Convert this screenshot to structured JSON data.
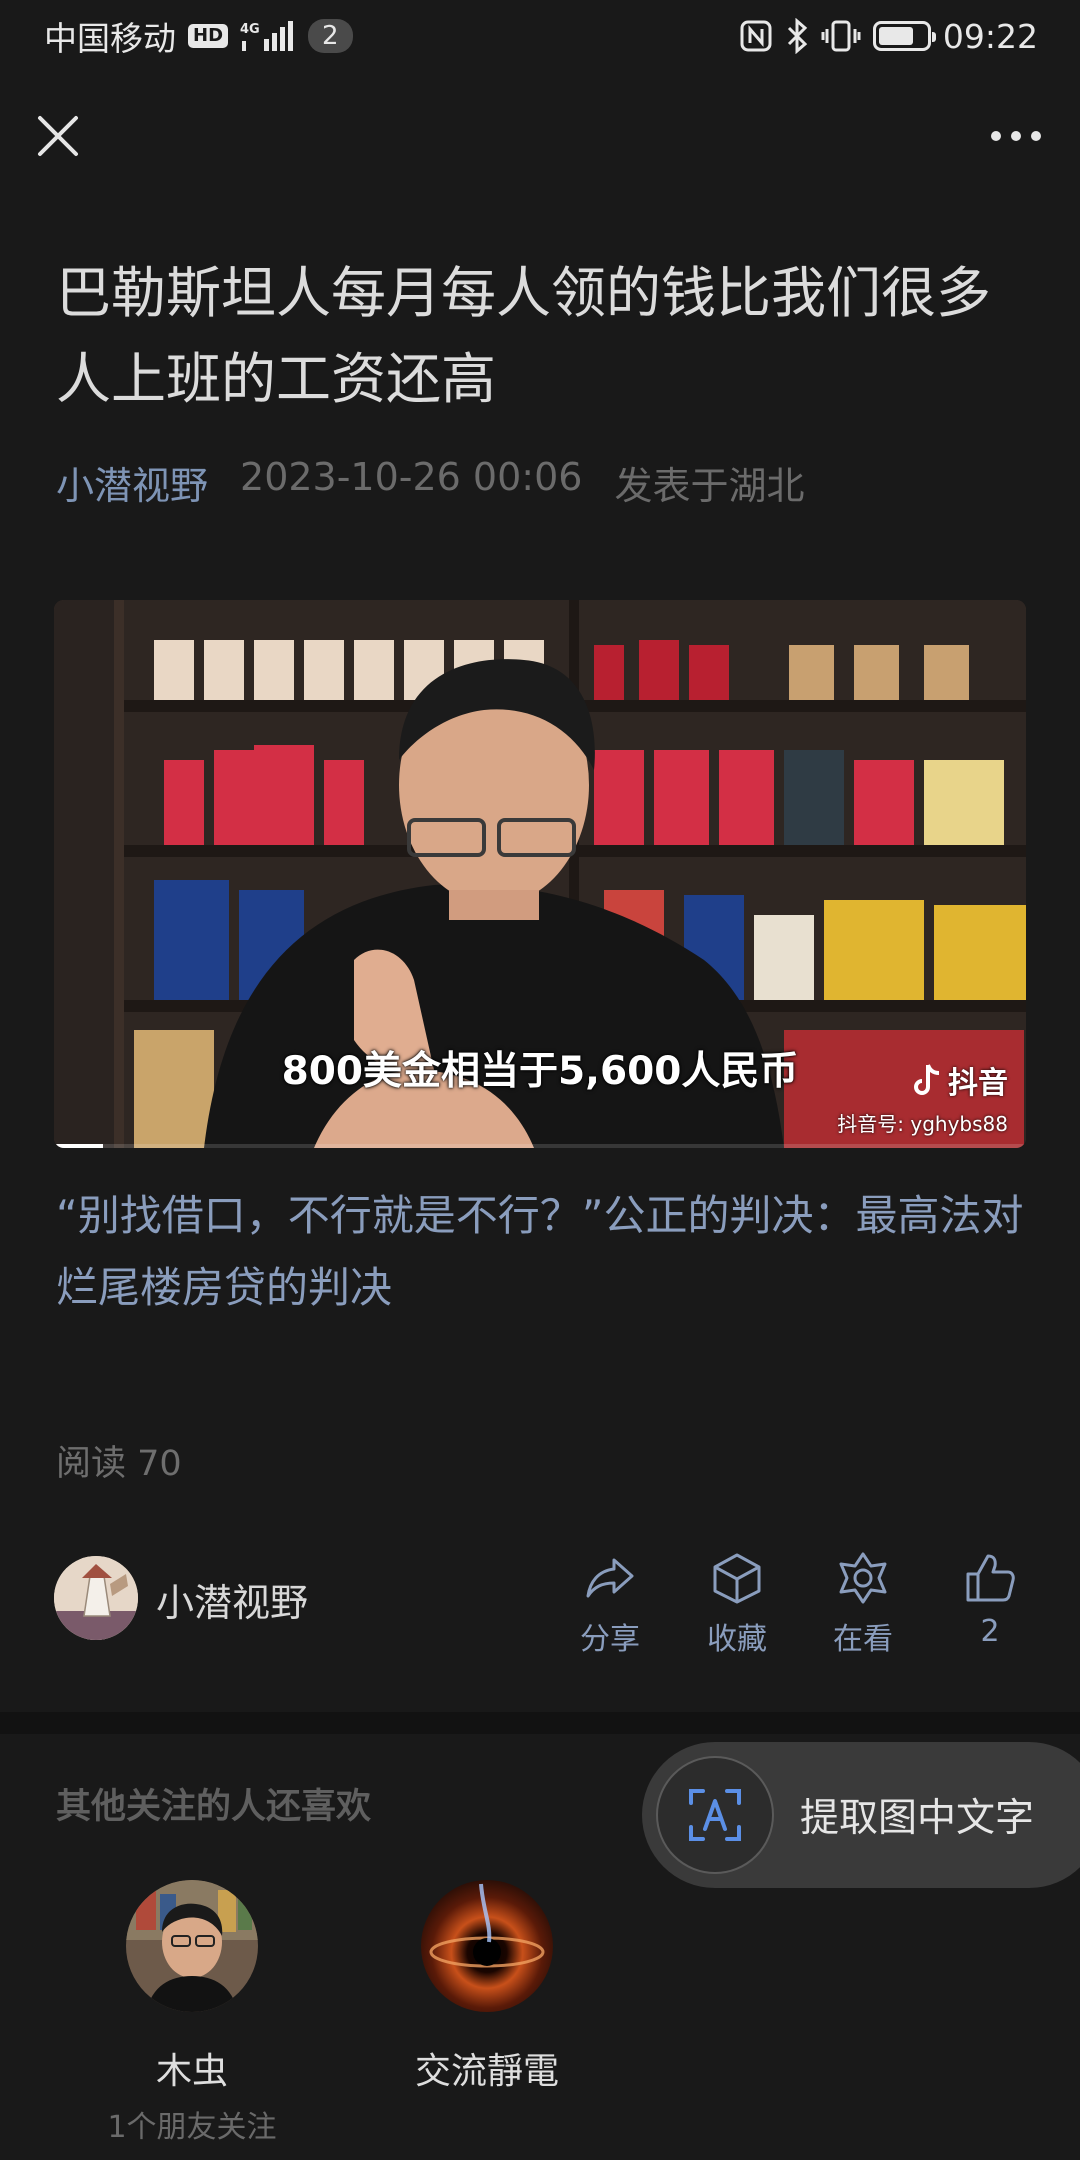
{
  "status_bar": {
    "carrier": "中国移动",
    "hd": "HD",
    "network": "4G",
    "notification_count": "2",
    "time": "09:22",
    "battery_level": 0.75
  },
  "article": {
    "title": "巴勒斯坦人每月每人领的钱比我们很多人上班的工资还高",
    "author": "小潜视野",
    "datetime": "2023-10-26 00:06",
    "location": "发表于湖北",
    "video": {
      "caption": "800美金相当于5,600人民币",
      "platform": "抖音",
      "platform_id": "抖音号: yghybs88",
      "progress": 0.05
    },
    "body": "“别找借口，不行就是不行？”公正的判决：最高法对烂尾楼房贷的判决",
    "read_count": "阅读 70"
  },
  "action_row": {
    "author_name": "小潜视野",
    "share_label": "分享",
    "favorite_label": "收藏",
    "watching_label": "在看",
    "like_count": "2"
  },
  "recommend": {
    "title": "其他关注的人还喜欢",
    "items": [
      {
        "name": "木虫",
        "sub": "1个朋友关注"
      },
      {
        "name": "交流靜電",
        "sub": ""
      }
    ]
  },
  "ocr_pill": {
    "label": "提取图中文字"
  }
}
